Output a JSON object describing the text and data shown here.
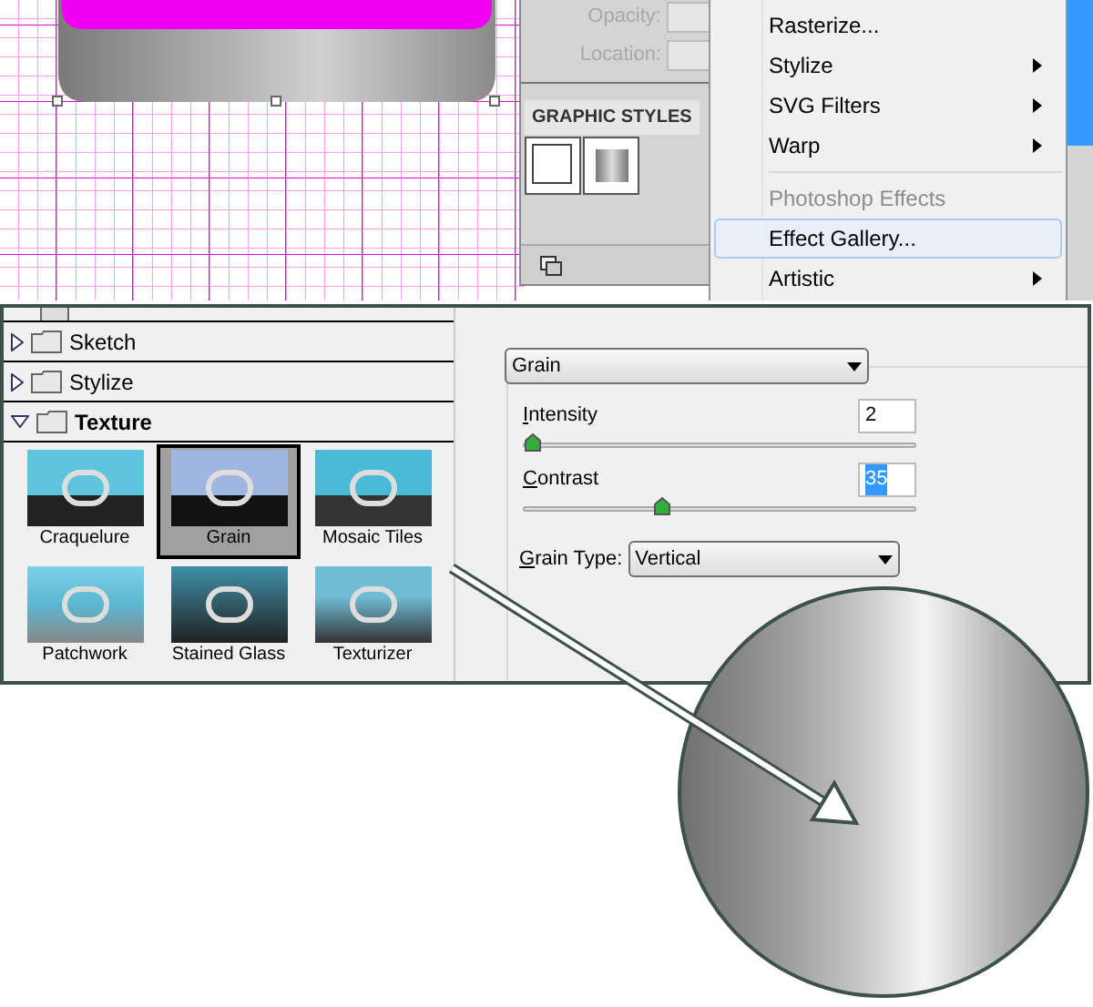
{
  "appearance_panel": {
    "fields": [
      {
        "label": "Opacity:"
      },
      {
        "label": "Location:"
      }
    ]
  },
  "graphic_styles": {
    "tab": "GRAPHIC STYLES"
  },
  "menu": {
    "items": [
      {
        "kind": "item",
        "label": "Rasterize...",
        "submenu": false,
        "disabled": false,
        "selected": false
      },
      {
        "kind": "item",
        "label": "Stylize",
        "submenu": true,
        "disabled": false,
        "selected": false
      },
      {
        "kind": "item",
        "label": "SVG Filters",
        "submenu": true,
        "disabled": false,
        "selected": false
      },
      {
        "kind": "item",
        "label": "Warp",
        "submenu": true,
        "disabled": false,
        "selected": false
      },
      {
        "kind": "separator"
      },
      {
        "kind": "item",
        "label": "Photoshop Effects",
        "submenu": false,
        "disabled": true,
        "selected": false
      },
      {
        "kind": "item",
        "label": "Effect Gallery...",
        "submenu": false,
        "disabled": false,
        "selected": true
      },
      {
        "kind": "item",
        "label": "Artistic",
        "submenu": true,
        "disabled": false,
        "selected": false
      }
    ]
  },
  "filter_list": {
    "categories": [
      {
        "label": "Sketch",
        "expanded": false
      },
      {
        "label": "Stylize",
        "expanded": false
      },
      {
        "label": "Texture",
        "expanded": true,
        "children": [
          {
            "label": "Craquelure",
            "selected": false
          },
          {
            "label": "Grain",
            "selected": true
          },
          {
            "label": "Mosaic Tiles",
            "selected": false
          },
          {
            "label": "Patchwork",
            "selected": false
          },
          {
            "label": "Stained Glass",
            "selected": false
          },
          {
            "label": "Texturizer",
            "selected": false
          }
        ]
      }
    ]
  },
  "settings": {
    "filter": "Grain",
    "sliders": [
      {
        "label": "Intensity",
        "value": "2",
        "level": 0.02,
        "selected": false
      },
      {
        "label": "Contrast",
        "value": "35",
        "level": 0.35,
        "selected": true
      }
    ],
    "grain_type": {
      "label": "Grain Type:",
      "value": "Vertical"
    }
  }
}
